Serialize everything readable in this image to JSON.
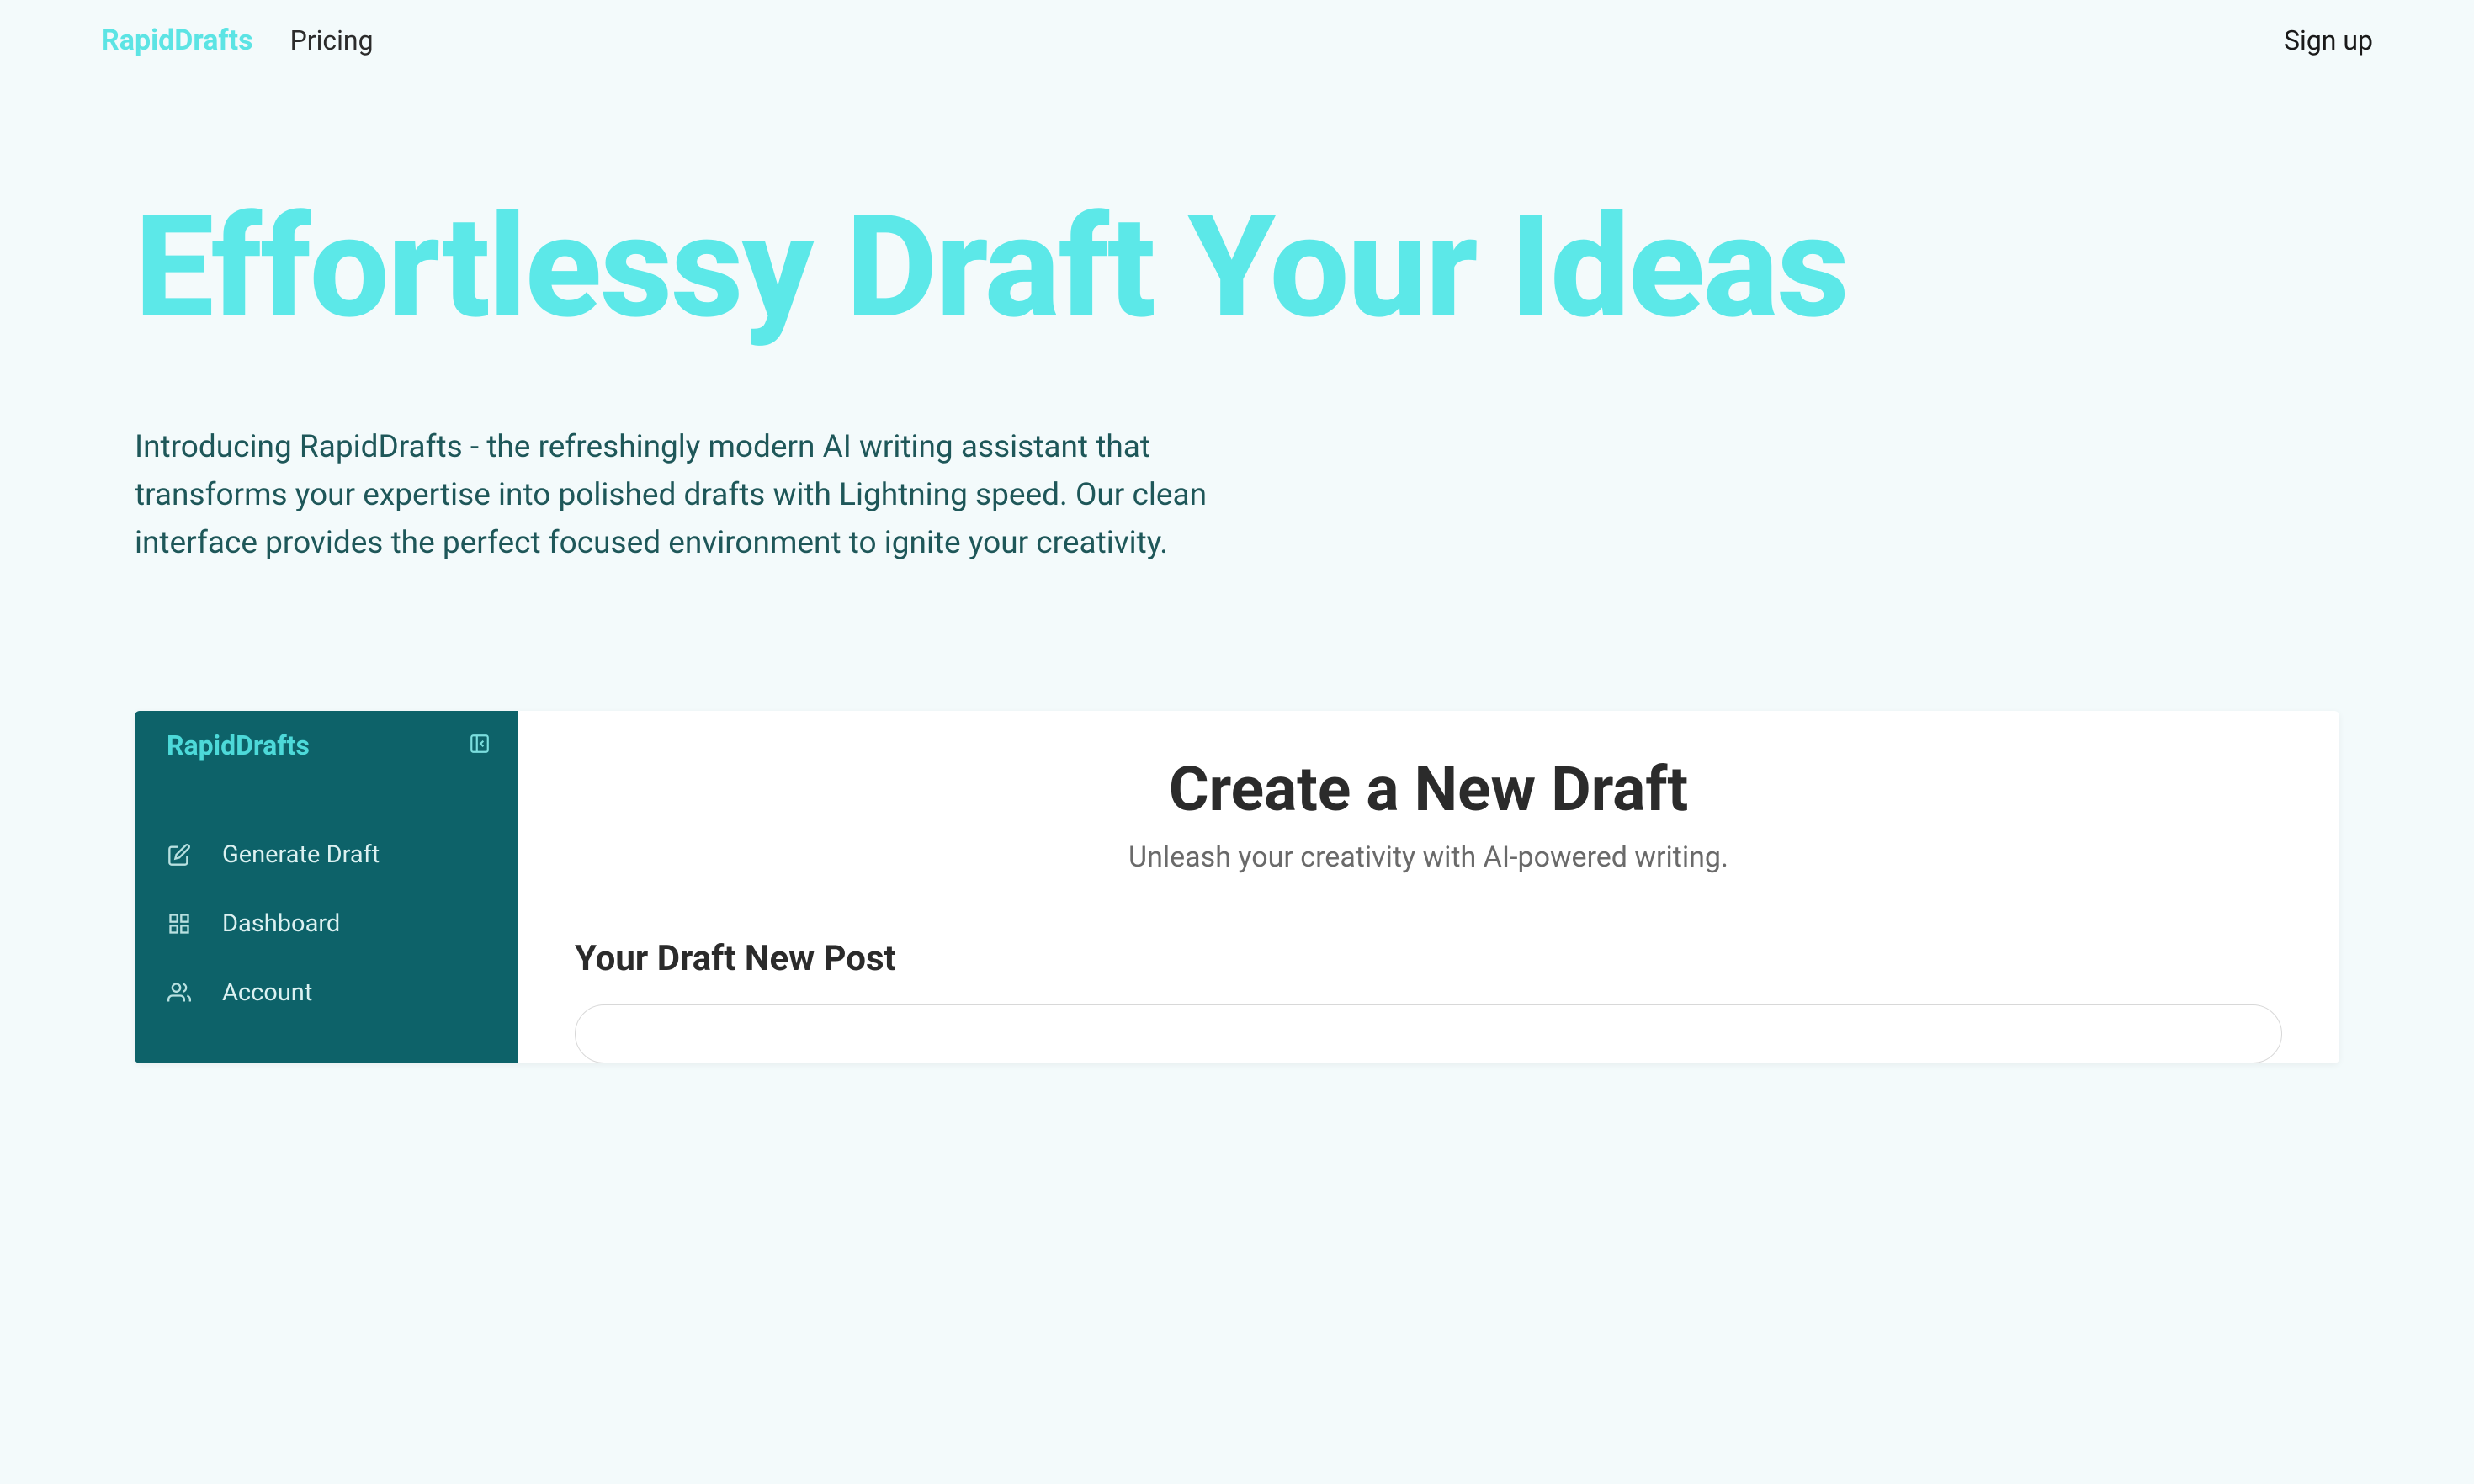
{
  "header": {
    "logo": "RapidDrafts",
    "nav": {
      "pricing": "Pricing"
    },
    "signup": "Sign up"
  },
  "hero": {
    "title": "Effortlessy Draft Your Ideas",
    "description": "Introducing RapidDrafts - the refreshingly modern AI writing assistant that transforms your expertise into polished drafts with Lightning speed. Our clean interface provides the perfect focused environment to ignite your creativity."
  },
  "demo": {
    "sidebar": {
      "logo": "RapidDrafts",
      "items": [
        {
          "label": "Generate Draft"
        },
        {
          "label": "Dashboard"
        },
        {
          "label": "Account"
        }
      ]
    },
    "main": {
      "title": "Create a New Draft",
      "subtitle": "Unleash your creativity with AI-powered writing.",
      "section_title": "Your Draft New Post"
    }
  }
}
